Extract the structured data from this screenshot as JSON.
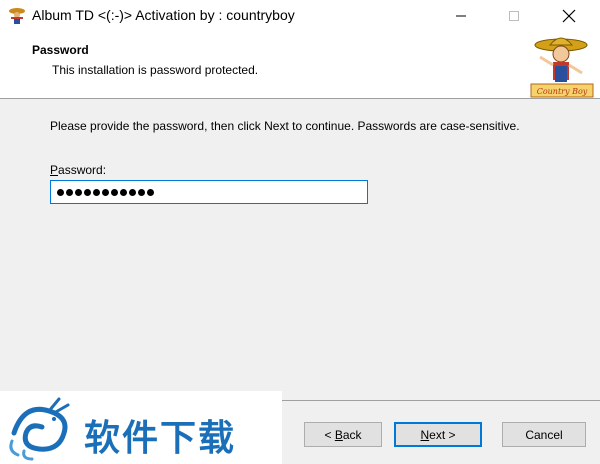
{
  "window": {
    "title": "Album TD <(:-)> Activation by : countryboy"
  },
  "header": {
    "title": "Password",
    "subtitle": "This installation is password protected.",
    "logo_text": "Country Boy"
  },
  "body": {
    "instruction": "Please provide the password, then click Next to continue. Passwords are case-sensitive.",
    "password_label_prefix": "P",
    "password_label_rest": "assword:",
    "password_dots": 11
  },
  "footer": {
    "back_label_prefix": "< ",
    "back_label_key": "B",
    "back_label_rest": "ack",
    "next_label_key": "N",
    "next_label_rest": "ext >",
    "cancel_label": "Cancel"
  },
  "watermark": {
    "brand_text": "软件下载"
  },
  "colors": {
    "accent": "#0078d7",
    "brand": "#1a6fb8"
  }
}
